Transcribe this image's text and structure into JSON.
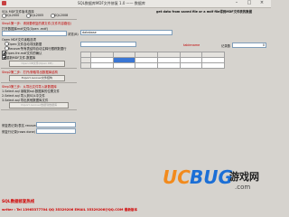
{
  "window": {
    "title": "SQL数据库MDF文件修复 1.0 —— 数据库",
    "minimize": "–",
    "maximize": "□",
    "close": "×"
  },
  "left": {
    "version_label": "SQL MDF文件版本选择",
    "version_options": [
      "SQL2000",
      "SQL2005",
      "SQL2008"
    ],
    "step1": "Step1第一步：请到要修复的源文件(文件内容路径)",
    "mdf_label": "打开数据库mdf文件(Open .mdf)",
    "mdf_browse": "浏览(B)",
    "option_a": "Open MDF文件读取选项",
    "option_b": "Open:文件自动寻找数据",
    "option_c": "Recover所有表结构自动注释行跟踪数据行",
    "check_d": "Open.fre.mdf文件的确认",
    "check_e": "重新MDF文件.数据库",
    "open_button": "Open DB文件(Open DB)",
    "step2": "Step2第二步：打开/获取导出数据库结构",
    "export_button": "Export.recover文件结构",
    "step3": "Step3第三步：从导出文件导入新数据库",
    "line_a": "1.Select.sql 读取到sql.数据库的位置文件",
    "line_b": "2.Select.sql 导入到SQL中文件",
    "line_c": "3.Select.sql 导出其他数据库文件",
    "import_button": "Import.recover数据到数据库",
    "table_label": "修复表记录(表名 recovery)",
    "rows_label": "修复行记录(rows done)",
    "hotline": "SQL数据修复热线",
    "contact": "writer : Tel 13965377704 QQ 35329206 EMAIL 35329206@QQ.COM 最新版本"
  },
  "right": {
    "header_note": "get data from saved file or a mdf file得到MDF文件表的数据",
    "db_field": "database",
    "table_field": "tablename",
    "count_label": "记录数",
    "count_value": "0"
  },
  "logo": {
    "brand": "UCBUG",
    "tagline": "游戏网",
    "domain": ".com"
  },
  "colors": {
    "accent_red": "#c00000",
    "selection": "#3a76d4",
    "logo_orange": "#f28a1c",
    "logo_blue": "#1c6fd6"
  }
}
